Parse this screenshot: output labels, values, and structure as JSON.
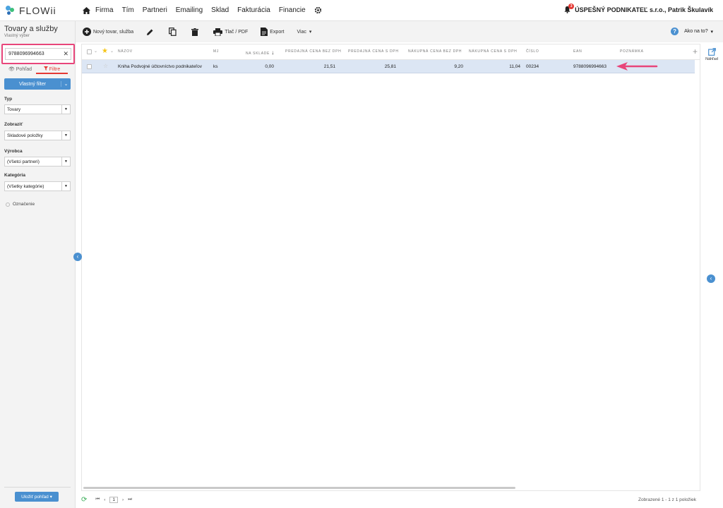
{
  "app": {
    "logo_text": "FLOWii",
    "nav": [
      "Firma",
      "Tím",
      "Partneri",
      "Emailing",
      "Sklad",
      "Fakturácia",
      "Financie"
    ],
    "company": "ÚSPEŠNÝ PODNIKATEĽ s.r.o., Patrik Škulavík",
    "notification_count": "3"
  },
  "left": {
    "title": "Tovary a služby",
    "subtitle": "Vlastný výber",
    "search_value": "9788096994663",
    "tabs": [
      "Pohľad",
      "Filtre"
    ],
    "custom_filter": "Vlastný filter",
    "filters": [
      {
        "label": "Typ",
        "value": "Tovary"
      },
      {
        "label": "Zobraziť",
        "value": "Skladové položky"
      },
      {
        "label": "Výrobca",
        "value": "(Všetci partneri)"
      },
      {
        "label": "Kategória",
        "value": "(Všetky kategórie)"
      }
    ],
    "marked_label": "Označenie",
    "apply_button": "Uložiť pohľad"
  },
  "toolbar": {
    "new_item": "Nový tovar, služba",
    "print": "Tlač / PDF",
    "export": "Export",
    "more": "Viac",
    "help": "Ako na to?"
  },
  "grid": {
    "columns": [
      "NÁZOV",
      "MJ",
      "NA SKLADE",
      "PREDAJNÁ CENA BEZ DPH",
      "PREDAJNÁ CENA S DPH",
      "NÁKUPNÁ CENA BEZ DPH",
      "NÁKUPNÁ CENA S DPH",
      "ČÍSLO",
      "EAN",
      "POZNÁMKA"
    ],
    "rows": [
      {
        "name": "Kniha Podvojné účtovníctvo podnikateľov",
        "unit": "ks",
        "stock": "0,00",
        "sale_net": "21,51",
        "sale_gross": "25,81",
        "buy_net": "9,20",
        "buy_gross": "11,04",
        "number": "00234",
        "ean": "9788096994663",
        "note": ""
      }
    ]
  },
  "footer": {
    "page": "1",
    "summary": "Zobrazené 1 - 1 z 1 položiek"
  },
  "right": {
    "preview_label": "Náhľad"
  },
  "colors": {
    "accent_blue": "#4a90d0",
    "highlight_pink": "#e8457a",
    "active_red": "#e53935",
    "row_selected": "#dce6f4"
  },
  "icons": [
    "home-icon",
    "gear-icon",
    "bell-icon",
    "plus-circle-icon",
    "pencil-icon",
    "copy-icon",
    "trash-icon",
    "printer-icon",
    "export-icon",
    "help-icon",
    "external-link-icon",
    "refresh-icon",
    "star-icon",
    "funnel-icon",
    "eye-icon"
  ]
}
